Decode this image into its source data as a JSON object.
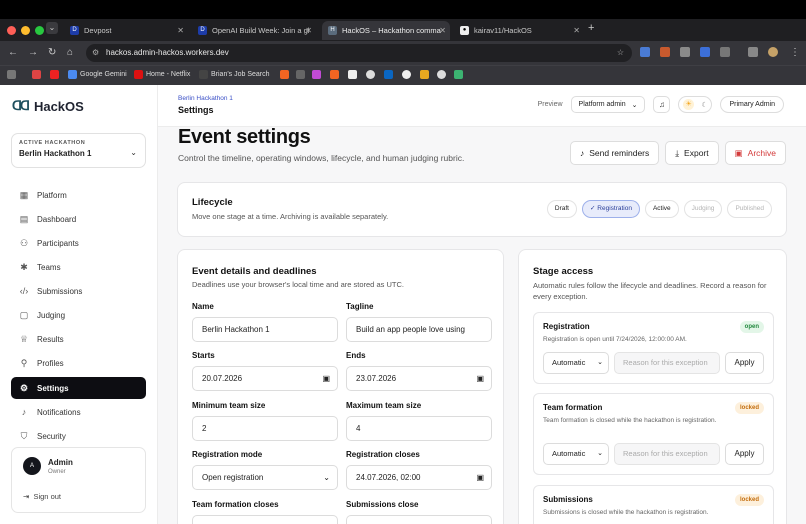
{
  "browser": {
    "tabs": [
      {
        "title": "Devpost",
        "favicon": "D"
      },
      {
        "title": "OpenAI Build Week: Join a gl",
        "favicon": "D"
      },
      {
        "title": "HackOS – Hackathon comma",
        "favicon": "H"
      },
      {
        "title": "kairav11/HackOS",
        "favicon": "gh"
      }
    ],
    "url": "hackos.admin-hackos.workers.dev",
    "bookmarks": [
      "Google Gemini",
      "Home - Netflix",
      "Brian's Job Search"
    ]
  },
  "sidebar": {
    "brand": "HackOS",
    "hackathon_label": "ACTIVE HACKATHON",
    "hackathon_value": "Berlin Hackathon 1",
    "items": [
      {
        "label": "Platform",
        "icon": "grid-icon"
      },
      {
        "label": "Dashboard",
        "icon": "dashboard-icon"
      },
      {
        "label": "Participants",
        "icon": "users-icon"
      },
      {
        "label": "Teams",
        "icon": "network-icon"
      },
      {
        "label": "Submissions",
        "icon": "code-icon"
      },
      {
        "label": "Judging",
        "icon": "clipboard-icon"
      },
      {
        "label": "Results",
        "icon": "trophy-icon"
      },
      {
        "label": "Profiles",
        "icon": "user-plus-icon"
      },
      {
        "label": "Settings",
        "icon": "gear-icon"
      },
      {
        "label": "Notifications",
        "icon": "bell-icon"
      },
      {
        "label": "Security",
        "icon": "shield-icon"
      }
    ],
    "user": {
      "initial": "A",
      "name": "Admin",
      "role": "Owner",
      "signout": "Sign out"
    }
  },
  "header": {
    "breadcrumb_parent": "Berlin Hackathon 1",
    "breadcrumb_current": "Settings",
    "preview_label": "Preview",
    "preview_value": "Platform admin",
    "role_label": "Primary Admin"
  },
  "page": {
    "title": "Event settings",
    "subtitle": "Control the timeline, operating windows, lifecycle, and human judging rubric.",
    "actions": {
      "reminders": "Send reminders",
      "export": "Export",
      "archive": "Archive"
    }
  },
  "lifecycle": {
    "title": "Lifecycle",
    "subtitle": "Move one stage at a time. Archiving is available separately.",
    "stages": [
      "Draft",
      "Registration",
      "Active",
      "Judging",
      "Published"
    ],
    "current": "Registration"
  },
  "details": {
    "title": "Event details and deadlines",
    "subtitle": "Deadlines use your browser's local time and are stored as UTC.",
    "fields": {
      "name_label": "Name",
      "name_value": "Berlin Hackathon 1",
      "tagline_label": "Tagline",
      "tagline_value": "Build an app people love using",
      "starts_label": "Starts",
      "starts_value": "20.07.2026",
      "ends_label": "Ends",
      "ends_value": "23.07.2026",
      "min_label": "Minimum team size",
      "min_value": "2",
      "max_label": "Maximum team size",
      "max_value": "4",
      "regmode_label": "Registration mode",
      "regmode_value": "Open registration",
      "regclose_label": "Registration closes",
      "regclose_value": "24.07.2026, 02:00",
      "teamclose_label": "Team formation closes",
      "subclose_label": "Submissions close"
    }
  },
  "access": {
    "title": "Stage access",
    "subtitle": "Automatic rules follow the lifecycle and deadlines. Record a reason for every exception.",
    "stages": [
      {
        "title": "Registration",
        "status": "open",
        "desc": "Registration is open until 7/24/2026, 12:00:00 AM.",
        "mode": "Automatic",
        "reason_placeholder": "Reason for this exception",
        "apply": "Apply"
      },
      {
        "title": "Team formation",
        "status": "locked",
        "desc": "Team formation is closed while the hackathon is registration.",
        "mode": "Automatic",
        "reason_placeholder": "Reason for this exception",
        "apply": "Apply"
      },
      {
        "title": "Submissions",
        "status": "locked",
        "desc": "Submissions is closed while the hackathon is registration."
      }
    ]
  }
}
